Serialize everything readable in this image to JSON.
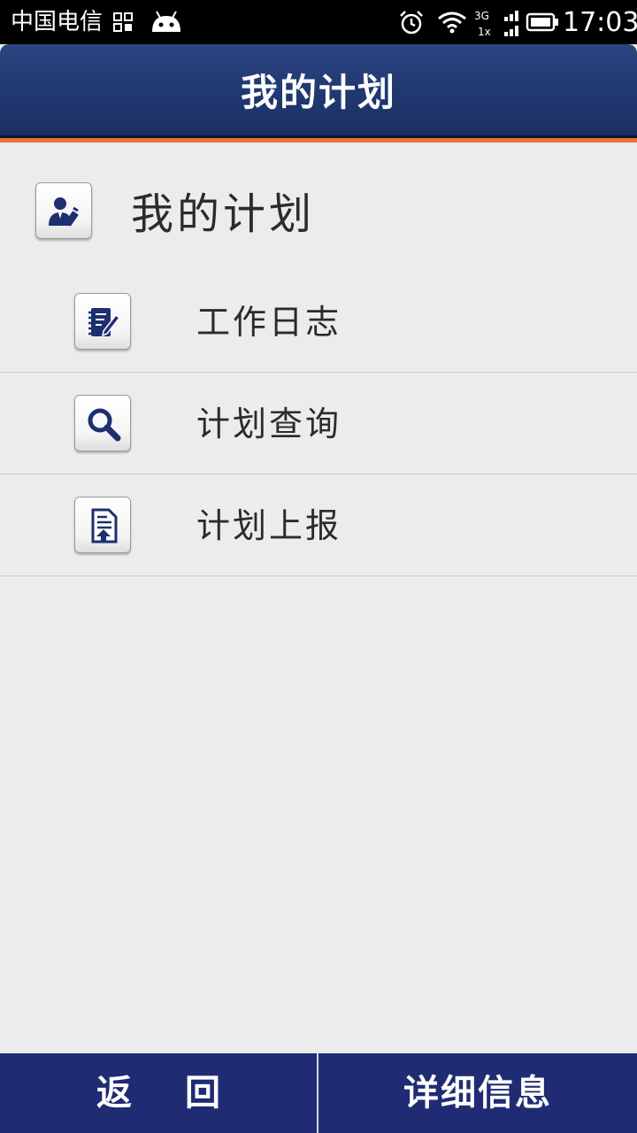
{
  "status_bar": {
    "carrier": "中国电信",
    "time": "17:03",
    "network_top": "3G",
    "network_bottom": "1x"
  },
  "header": {
    "title": "我的计划"
  },
  "section": {
    "title": "我的计划",
    "icon": "user-edit-icon"
  },
  "menu": {
    "items": [
      {
        "label": "工作日志",
        "icon": "journal-edit-icon"
      },
      {
        "label": "计划查询",
        "icon": "search-icon"
      },
      {
        "label": "计划上报",
        "icon": "document-upload-icon"
      }
    ]
  },
  "bottom_bar": {
    "back_label": "返回",
    "detail_label": "详细信息"
  },
  "colors": {
    "header": "#223a74",
    "accent": "#e8703a",
    "bottom_bar": "#1f2b72",
    "icon": "#1d2f6f"
  }
}
